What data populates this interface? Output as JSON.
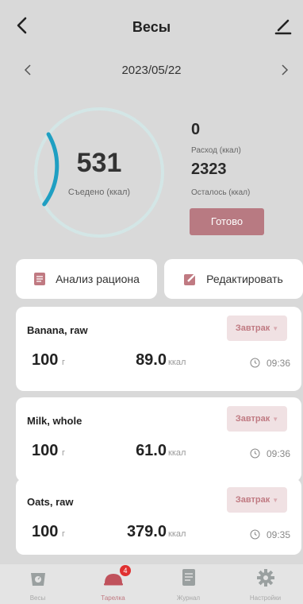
{
  "header": {
    "title": "Весы"
  },
  "date": {
    "current": "2023/05/22"
  },
  "summary": {
    "eaten_value": "531",
    "eaten_label": "Съедено (ккал)",
    "eaten_progress": 0.186,
    "expense_value": "0",
    "expense_label": "Расход (ккал)",
    "remaining_value": "2323",
    "remaining_label": "Осталось (ккал)",
    "done_label": "Готово"
  },
  "actions": {
    "analysis_label": "Анализ рациона",
    "edit_label": "Редактировать"
  },
  "entries": [
    {
      "name": "Banana, raw",
      "meal": "Завтрак",
      "qty": "100",
      "qty_unit": "г",
      "kcal": "89.0",
      "kcal_unit": "ккал",
      "time": "09:36"
    },
    {
      "name": "Milk, whole",
      "meal": "Завтрак",
      "qty": "100",
      "qty_unit": "г",
      "kcal": "61.0",
      "kcal_unit": "ккал",
      "time": "09:36"
    },
    {
      "name": "Oats, raw",
      "meal": "Завтрак",
      "qty": "100",
      "qty_unit": "г",
      "kcal": "379.0",
      "kcal_unit": "ккал",
      "time": "09:35"
    }
  ],
  "tabs": [
    {
      "label": "Весы",
      "icon": "scale-icon"
    },
    {
      "label": "Тарелка",
      "icon": "plate-icon",
      "badge": "4",
      "active": true
    },
    {
      "label": "Журнал",
      "icon": "journal-icon"
    },
    {
      "label": "Настройки",
      "icon": "gear-icon"
    }
  ],
  "colors": {
    "background": "#d9d9d9",
    "accent": "#b87a82",
    "ring_track": "#d3e6e6",
    "ring_progress": "#1f9fc2",
    "badge": "#e03030"
  }
}
